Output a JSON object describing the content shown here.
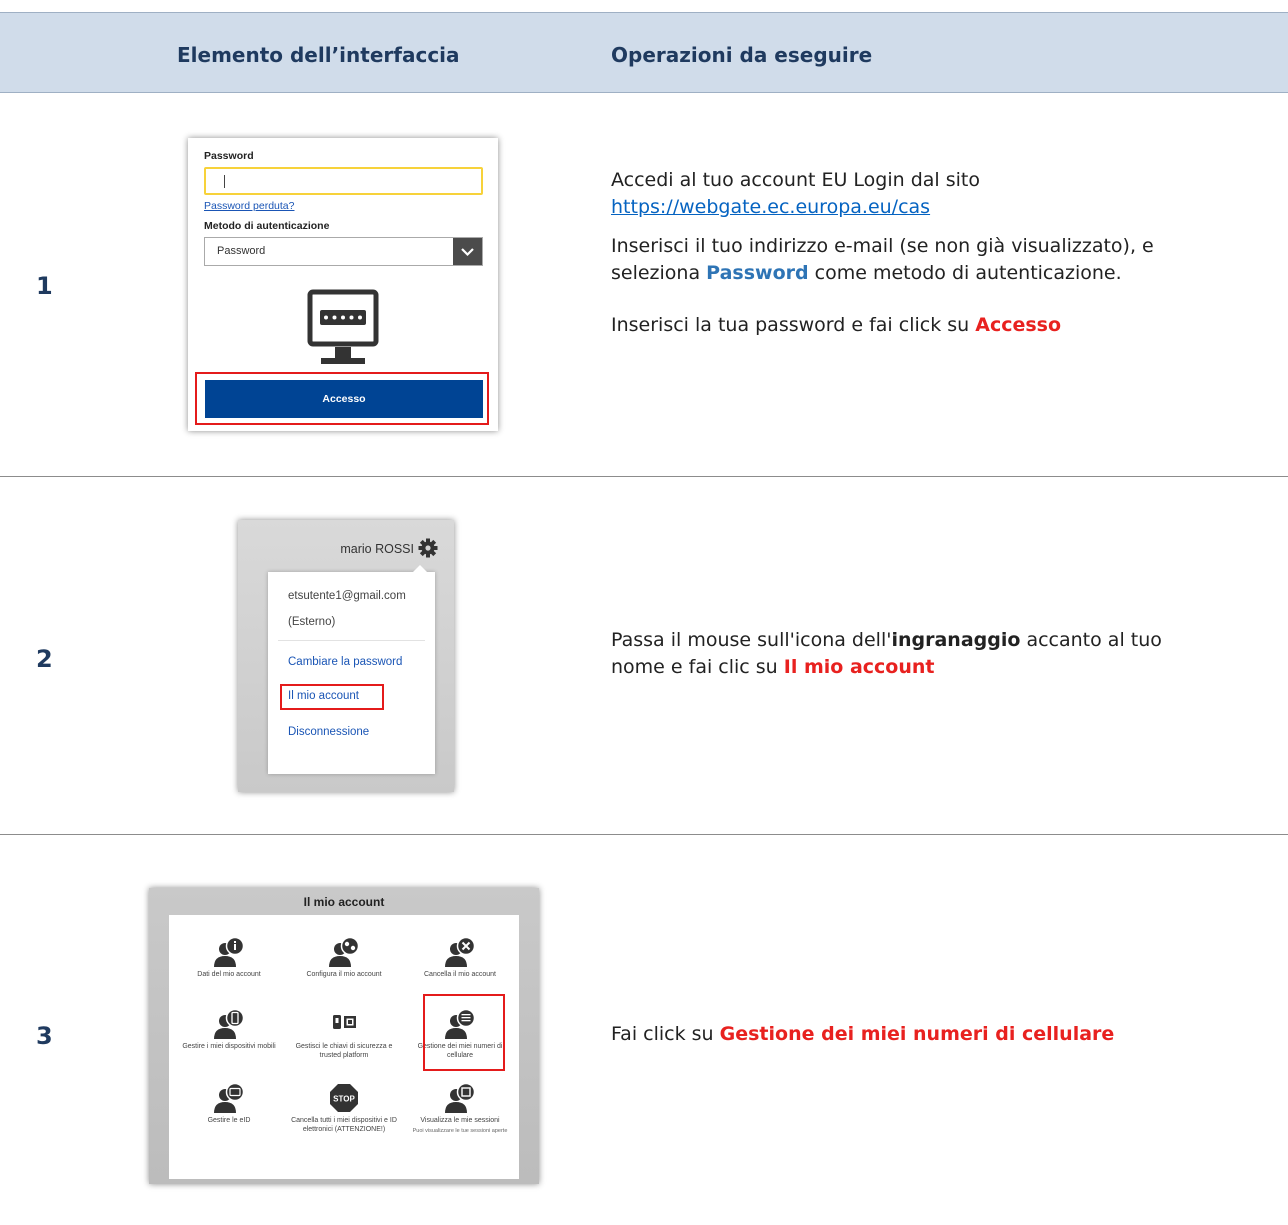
{
  "header": {
    "col1": "Elemento dell’interfaccia",
    "col2": "Operazioni da eseguire"
  },
  "steps": [
    {
      "number": "1",
      "login_panel": {
        "password_label": "Password",
        "lost_password_link": "Password perduta?",
        "auth_method_label": "Metodo di autenticazione",
        "auth_method_value": "Password",
        "login_button": "Accesso"
      },
      "instructions": {
        "line1": "Accedi al tuo account EU Login dal sito",
        "url": "https://webgate.ec.europa.eu/cas",
        "line2a": "Inserisci il tuo indirizzo e-mail (se non già visualizzato), e",
        "line2b_pre": "seleziona ",
        "line2b_bold": "Password",
        "line2b_post": " come metodo di autenticazione.",
        "line3_pre": "Inserisci la tua password e fai click su ",
        "line3_bold": "Accesso"
      }
    },
    {
      "number": "2",
      "menu_panel": {
        "user_name": "mario ROSSI",
        "email": "etsutente1@gmail.com",
        "account_type": "(Esterno)",
        "change_password": "Cambiare la password",
        "my_account": "Il mio account",
        "logout": "Disconnessione"
      },
      "instructions": {
        "line1_pre": "Passa il mouse sull'icona dell'",
        "line1_bold": "ingranaggio",
        "line1_post": " accanto al tuo",
        "line2_pre": "nome e fai clic su ",
        "line2_bold": "Il mio account"
      }
    },
    {
      "number": "3",
      "account_panel": {
        "title": "Il mio account",
        "items": [
          {
            "icon": "user-info-icon",
            "label": "Dati del mio account"
          },
          {
            "icon": "user-settings-icon",
            "label": "Configura il mio account"
          },
          {
            "icon": "user-delete-icon",
            "label": "Cancella il mio account"
          },
          {
            "icon": "user-mobile-icon",
            "label": "Gestire i miei dispositivi mobili"
          },
          {
            "icon": "security-keys-icon",
            "label": "Gestisci le chiavi di sicurezza e trusted platform"
          },
          {
            "icon": "user-phone-number-icon",
            "label": "Gestione dei miei numeri di cellulare"
          },
          {
            "icon": "user-eid-icon",
            "label": "Gestire le eID"
          },
          {
            "icon": "stop-icon",
            "label": "Cancella tutti i miei dispositivi e ID elettronici (ATTENZIONE!)"
          },
          {
            "icon": "user-sessions-icon",
            "label": "Visualizza le mie sessioni",
            "sublabel": "Puoi visualizzare le tue sessioni aperte"
          }
        ]
      },
      "instructions": {
        "line1_pre": "Fai click su ",
        "line1_bold": "Gestione dei miei numeri di cellulare"
      }
    }
  ]
}
